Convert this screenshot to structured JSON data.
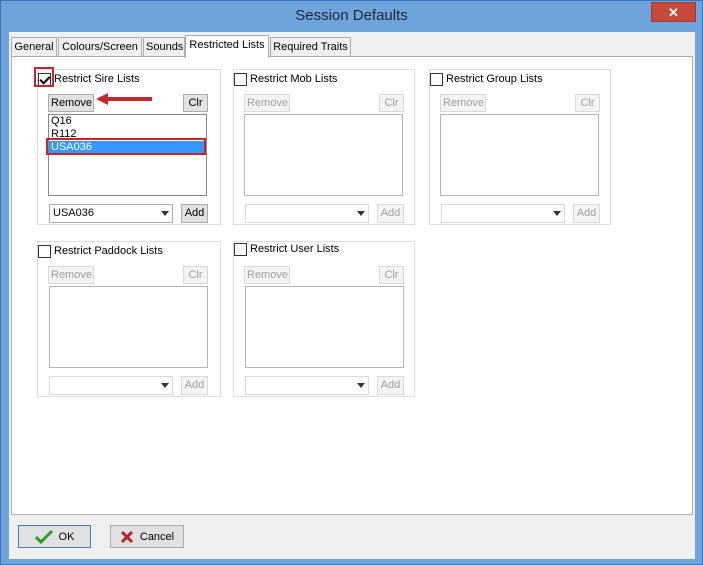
{
  "window": {
    "title": "Session Defaults",
    "close_glyph": "✕"
  },
  "tabs": [
    {
      "label": "General"
    },
    {
      "label": "Colours/Screen"
    },
    {
      "label": "Sounds"
    },
    {
      "label": "Restricted Lists"
    },
    {
      "label": "Required Traits"
    }
  ],
  "sire": {
    "label": "Restrict Sire Lists",
    "checked": true,
    "remove_label": "Remove",
    "clr_label": "Clr",
    "items": [
      "Q16",
      "R112",
      "USA036"
    ],
    "selected_item": "USA036",
    "combo_value": "USA036",
    "add_label": "Add"
  },
  "mob": {
    "label": "Restrict Mob Lists",
    "remove_label": "Remove",
    "clr_label": "Clr",
    "add_label": "Add"
  },
  "group": {
    "label": "Restrict Group Lists",
    "remove_label": "Remove",
    "clr_label": "Clr",
    "add_label": "Add"
  },
  "paddock": {
    "label": "Restrict Paddock Lists",
    "remove_label": "Remove",
    "clr_label": "Clr",
    "add_label": "Add"
  },
  "user": {
    "label": "Restrict User Lists",
    "remove_label": "Remove",
    "clr_label": "Clr",
    "add_label": "Add"
  },
  "footer": {
    "ok_label": "OK",
    "cancel_label": "Cancel"
  },
  "colors": {
    "annotation_red": "#c0282d",
    "selection_blue": "#3399ff"
  }
}
